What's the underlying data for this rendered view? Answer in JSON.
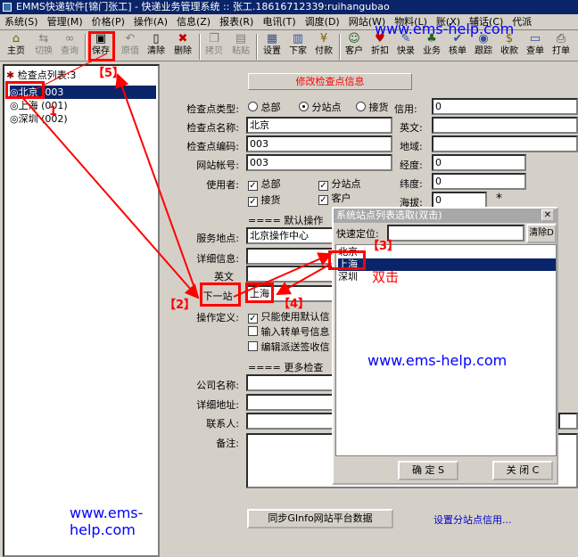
{
  "window": {
    "title": "EMMS快递软件[锦门张工] - 快递业务管理系统 :: 张工.18616712339:ruihangubao"
  },
  "menu": [
    "系统(S)",
    "管理(M)",
    "价格(P)",
    "操作(A)",
    "信息(Z)",
    "报表(R)",
    "电讯(T)",
    "调度(D)",
    "网站(W)",
    "物料(L)",
    "账(X)",
    "辅话(C)",
    "代派"
  ],
  "toolbar": {
    "home": "主页",
    "switch": "切换",
    "query": "查询",
    "save": "保存",
    "original": "原值",
    "clear": "清除",
    "delete": "删除",
    "copy_page": "拷贝",
    "paste": "粘贴",
    "settings": "设置",
    "order": "下家",
    "payment": "付款",
    "customer": "客户",
    "discount": "折扣",
    "express": "快录",
    "business": "业务",
    "check": "核单",
    "track": "跟踪",
    "collect": "收款",
    "lookup": "查单",
    "print": "打单"
  },
  "tree": {
    "header": "检查点列表:3",
    "items": [
      "◎北京 (003",
      "◎上海 (001)",
      "◎深圳 (002)"
    ]
  },
  "form": {
    "modify_button": "修改检查点信息",
    "type_label": "检查点类型:",
    "type_options": [
      "总部",
      "分站点",
      "接货"
    ],
    "name_label": "检查点名称:",
    "name_value": "北京",
    "code_label": "检查点编码:",
    "code_value": "003",
    "account_label": "网站帐号:",
    "account_value": "003",
    "user_label": "使用者:",
    "user_options": [
      "总部",
      "分站点",
      "接货",
      "客户"
    ],
    "credit_label": "信用:",
    "credit_value": "0",
    "english_label": "英文:",
    "region_label": "地域:",
    "lng_label": "经度:",
    "lng_value": "0",
    "lat_label": "纬度:",
    "lat_value": "0",
    "alt_label": "海拔:",
    "alt_value": "0",
    "star": "*",
    "default_ops": "==== 默认操作",
    "service_label": "服务地点:",
    "service_value": "北京操作中心",
    "detail_label": "详细信息:",
    "english2_label": "英文",
    "next_label": "下一站",
    "next_value": "上海",
    "opdef_label": "操作定义:",
    "opdef_options": [
      "只能使用默认信",
      "输入转单号信息",
      "编辑派送签收信"
    ],
    "more_check": "==== 更多检查",
    "company_label": "公司名称:",
    "address_label": "详细地址:",
    "contact_label": "联系人:",
    "note_label": "备注:",
    "sync_button": "同步GInfo网站平台数据",
    "set_credit_link": "设置分站点信用..."
  },
  "popup": {
    "title": "系统站点列表选取(双击)",
    "close": "✕",
    "quick_label": "快速定位:",
    "clear_button": "清除D",
    "items": [
      "北京",
      "上海",
      "深圳"
    ],
    "ok_button": "确  定 S",
    "close_button": "关  闭 C"
  },
  "annotations": {
    "watermark_top": "www.ems-help.com",
    "watermark_mid": "www.ems-help.com",
    "watermark_bottom": "www.ems-\nhelp.com",
    "label_1": "1",
    "label_2": "【2】",
    "label_3": "【3】",
    "label_4": "【4】",
    "label_5": "【5】",
    "double_click": "双击"
  },
  "colors": {
    "selection": "#0a246a",
    "annotation": "#ff0000",
    "watermark": "#0000ff",
    "titlebar": "#0a246a"
  }
}
